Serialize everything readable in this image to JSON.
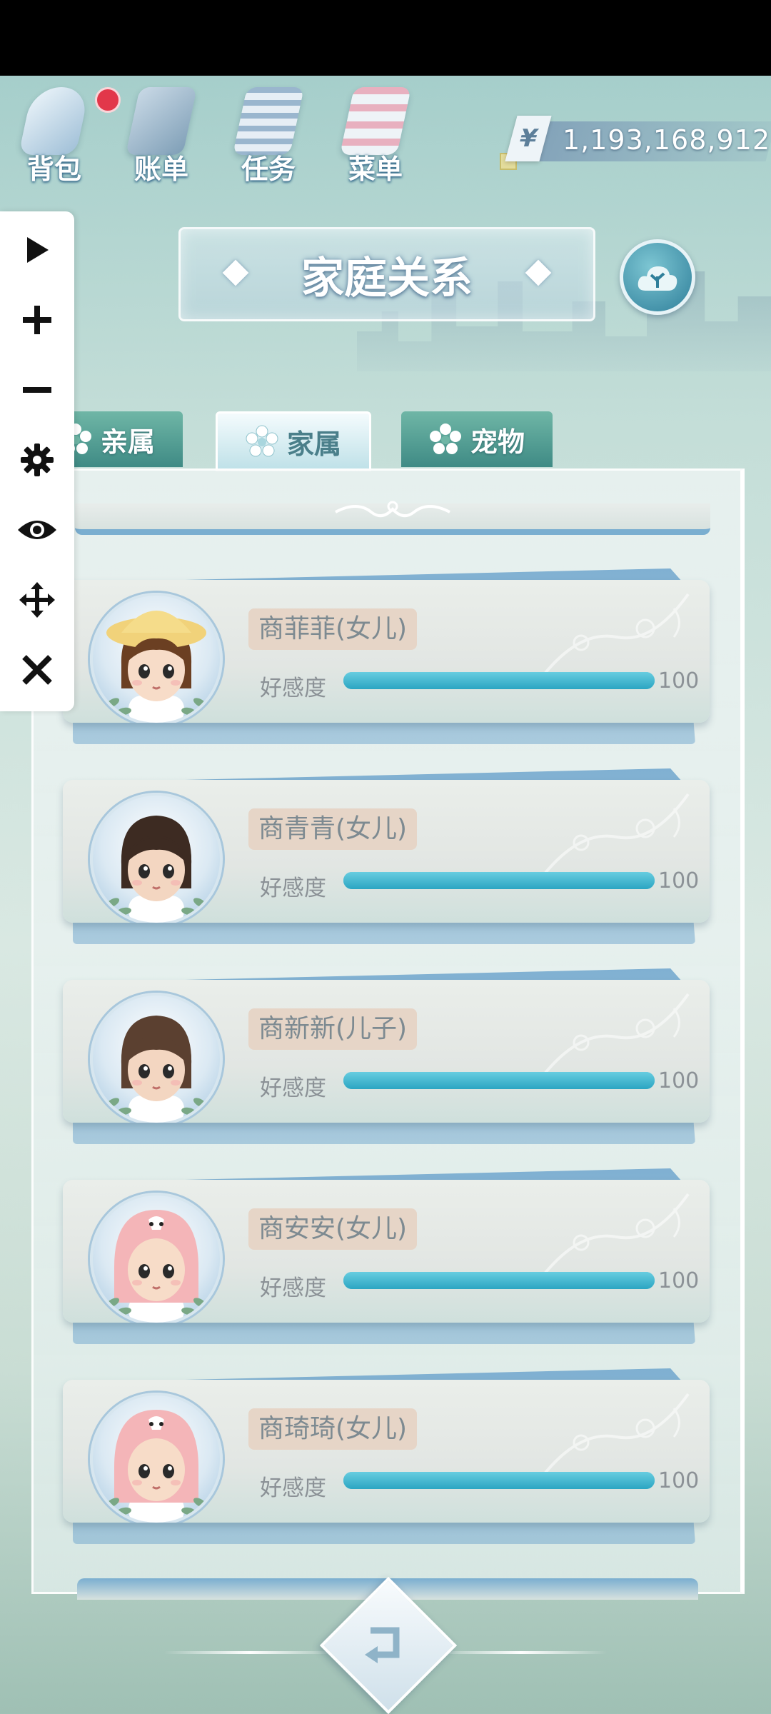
{
  "top_menu": {
    "bag_label": "背包",
    "bill_label": "账单",
    "task_label": "任务",
    "menu_label": "菜单",
    "currency_symbol": "¥",
    "money": "1,193,168,912"
  },
  "title": "家庭关系",
  "tabs": {
    "relatives": "亲属",
    "family": "家属",
    "pets": "宠物",
    "active": "家属"
  },
  "affection_label": "好感度",
  "members": [
    {
      "name": "商菲菲(女儿)",
      "affection": 100,
      "affection_text": "100",
      "avatar": "girl-yellow-hat"
    },
    {
      "name": "商青青(女儿)",
      "affection": 100,
      "affection_text": "100",
      "avatar": "girl-dark-hair"
    },
    {
      "name": "商新新(儿子)",
      "affection": 100,
      "affection_text": "100",
      "avatar": "boy-brown-hair"
    },
    {
      "name": "商安安(女儿)",
      "affection": 100,
      "affection_text": "100",
      "avatar": "baby-pink-costume"
    },
    {
      "name": "商琦琦(女儿)",
      "affection": 100,
      "affection_text": "100",
      "avatar": "baby-pink-costume"
    }
  ],
  "colors": {
    "affection_bar": "#3bb5cf",
    "name_tag": "#e6d5c7",
    "notification_dot": "#e2374a",
    "tab_inactive": "#3f8b85"
  },
  "sidebar_icons": [
    "play-icon",
    "plus-icon",
    "minus-icon",
    "gear-icon",
    "eye-icon",
    "move-icon",
    "close-icon"
  ]
}
